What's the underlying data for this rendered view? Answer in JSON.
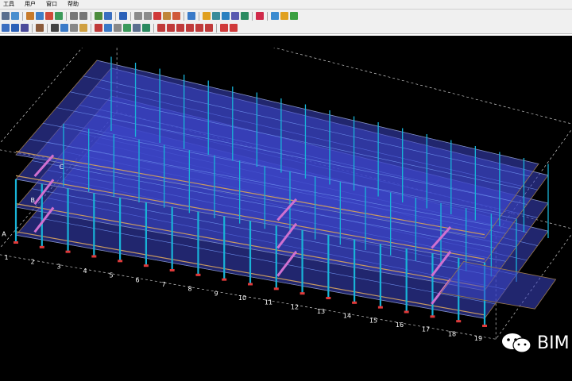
{
  "menu": {
    "items": [
      "工具",
      "用户",
      "窗口",
      "帮助"
    ]
  },
  "toolbar1": {
    "buttons": [
      {
        "icon": "save-icon",
        "color": "#5a6f8f"
      },
      {
        "icon": "open-icon",
        "color": "#4a8fcf"
      },
      {
        "icon": "sep"
      },
      {
        "icon": "model-icon",
        "color": "#c77a2a"
      },
      {
        "icon": "view-icon",
        "color": "#3f7fc8"
      },
      {
        "icon": "render-icon",
        "color": "#d04a3a"
      },
      {
        "icon": "window-icon",
        "color": "#3c9a5a"
      },
      {
        "icon": "sep"
      },
      {
        "icon": "undo-icon",
        "color": "#777777"
      },
      {
        "icon": "redo-icon",
        "color": "#777777"
      },
      {
        "icon": "sep"
      },
      {
        "icon": "grid-icon",
        "color": "#4c8c3c"
      },
      {
        "icon": "select-icon",
        "color": "#3a6ec0"
      },
      {
        "icon": "sep"
      },
      {
        "icon": "member-icon",
        "color": "#2a60b8"
      },
      {
        "icon": "sep"
      },
      {
        "icon": "line-icon",
        "color": "#8a8a8a"
      },
      {
        "icon": "angle-icon",
        "color": "#8a8a8a"
      },
      {
        "icon": "arc-icon",
        "color": "#d03a3a"
      },
      {
        "icon": "curve-icon",
        "color": "#c0863a"
      },
      {
        "icon": "circle-icon",
        "color": "#d05a3a"
      },
      {
        "icon": "sep"
      },
      {
        "icon": "move-icon",
        "color": "#3a7ac8"
      },
      {
        "icon": "sep"
      },
      {
        "icon": "layer-icon",
        "color": "#e0a020"
      },
      {
        "icon": "copy-icon",
        "color": "#3a8c9a"
      },
      {
        "icon": "array-icon",
        "color": "#2a80c0"
      },
      {
        "icon": "mirror-icon",
        "color": "#5a5ab0"
      },
      {
        "icon": "rotate-icon",
        "color": "#2a8a60"
      },
      {
        "icon": "sep"
      },
      {
        "icon": "report-icon",
        "color": "#d02a4a"
      },
      {
        "icon": "sep"
      },
      {
        "icon": "arrow-right-icon",
        "color": "#3a8ad0"
      },
      {
        "icon": "export-icon",
        "color": "#e0a020"
      },
      {
        "icon": "settings-icon",
        "color": "#3aa040"
      }
    ]
  },
  "toolbar2": {
    "buttons": [
      {
        "icon": "pen-icon",
        "color": "#3a6ec0"
      },
      {
        "icon": "brush-icon",
        "color": "#2a60b8"
      },
      {
        "icon": "pencil-icon",
        "color": "#4a4a9a"
      },
      {
        "icon": "sep"
      },
      {
        "icon": "text-icon",
        "color": "#8a5a3a"
      },
      {
        "icon": "sep"
      },
      {
        "icon": "bolt-icon",
        "color": "#444444"
      },
      {
        "icon": "weld-icon",
        "color": "#3a7ac8"
      },
      {
        "icon": "plate-icon",
        "color": "#888888"
      },
      {
        "icon": "cut-icon",
        "color": "#d0a040"
      },
      {
        "icon": "sep"
      },
      {
        "icon": "node-icon",
        "color": "#c03a3a"
      },
      {
        "icon": "pin-icon",
        "color": "#3a7ac8"
      },
      {
        "icon": "joint-icon",
        "color": "#888888"
      },
      {
        "icon": "connect-icon",
        "color": "#3a9a5a"
      },
      {
        "icon": "split-icon",
        "color": "#5a6f8f"
      },
      {
        "icon": "merge-icon",
        "color": "#2a8a60"
      },
      {
        "icon": "sep"
      },
      {
        "icon": "dim-icon",
        "color": "#c03a3a"
      },
      {
        "icon": "dim2-icon",
        "color": "#c03a3a"
      },
      {
        "icon": "dim3-icon",
        "color": "#c03a3a"
      },
      {
        "icon": "dim4-icon",
        "color": "#c03a3a"
      },
      {
        "icon": "dim5-icon",
        "color": "#c03a3a"
      },
      {
        "icon": "dim6-icon",
        "color": "#c03a3a"
      },
      {
        "icon": "sep"
      },
      {
        "icon": "check-icon",
        "color": "#d03a3a"
      },
      {
        "icon": "target-icon",
        "color": "#d03a3a"
      }
    ]
  },
  "viewport": {
    "grid_labels": [
      "1",
      "2",
      "3",
      "4",
      "5",
      "6",
      "7",
      "8",
      "9",
      "10",
      "11",
      "12",
      "13",
      "14",
      "15",
      "16",
      "17",
      "18",
      "19"
    ],
    "row_labels": [
      "A",
      "B",
      "C"
    ],
    "background": "#000000"
  },
  "watermark": {
    "text": "BIM"
  }
}
